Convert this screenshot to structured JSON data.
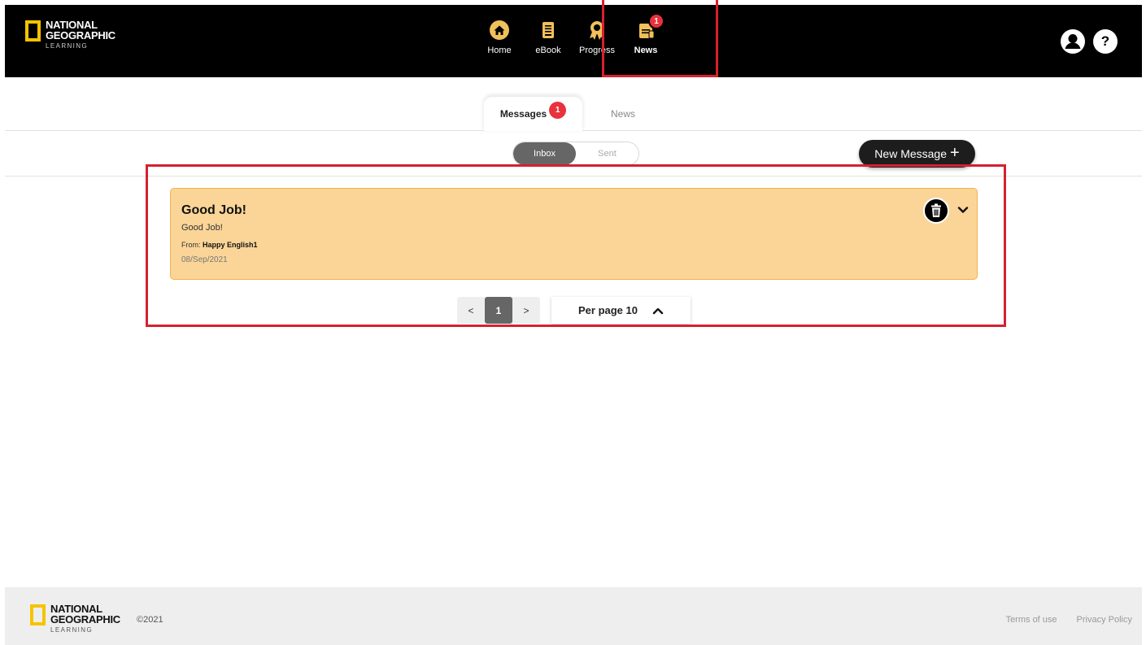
{
  "header": {
    "logo": {
      "line1": "NATIONAL",
      "line2": "GEOGRAPHIC",
      "line3": "LEARNING"
    },
    "nav": [
      {
        "label": "Home",
        "icon": "home-icon"
      },
      {
        "label": "eBook",
        "icon": "ebook-icon"
      },
      {
        "label": "Progress",
        "icon": "progress-icon"
      },
      {
        "label": "News",
        "icon": "news-icon",
        "badge": "1",
        "active": true
      }
    ],
    "right_icons": [
      "user-icon",
      "help-icon"
    ],
    "help_glyph": "?"
  },
  "tabs": [
    {
      "label": "Messages",
      "badge": "1",
      "active": true
    },
    {
      "label": "News",
      "active": false
    }
  ],
  "toggle": {
    "inbox": "Inbox",
    "sent": "Sent",
    "selected": "Inbox"
  },
  "new_message": {
    "label": "New Message",
    "plus": "+"
  },
  "messages": [
    {
      "title": "Good Job!",
      "body": "Good Job!",
      "from_label": "From:",
      "from": "Happy English1",
      "date": "08/Sep/2021"
    }
  ],
  "pagination": {
    "prev": "<",
    "current": "1",
    "next": ">",
    "per_page_label": "Per page 10"
  },
  "footer": {
    "copyright": "©2021",
    "links": [
      "Terms of use",
      "Privacy Policy"
    ]
  },
  "colors": {
    "brand_yellow": "#f5c400",
    "card_bg": "#fad597",
    "badge_red": "#e8323c",
    "highlight_red": "#d62030"
  }
}
